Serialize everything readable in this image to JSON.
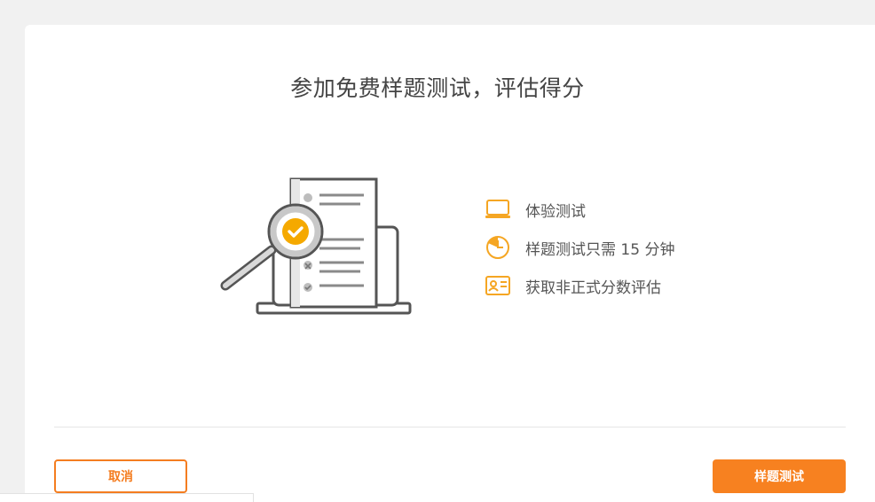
{
  "dialog": {
    "title": "参加免费样题测试，评估得分",
    "features": [
      {
        "icon": "laptop-icon",
        "label": "体验测试"
      },
      {
        "icon": "timer-icon",
        "label": "样题测试只需 15 分钟"
      },
      {
        "icon": "id-card-icon",
        "label": "获取非正式分数评估"
      }
    ],
    "cancel_label": "取消",
    "primary_label": "样题测试"
  },
  "colors": {
    "accent": "#f78120",
    "icon": "#f5a623",
    "check": "#f5a900",
    "text": "#555555",
    "background": "#f1f1f1"
  }
}
